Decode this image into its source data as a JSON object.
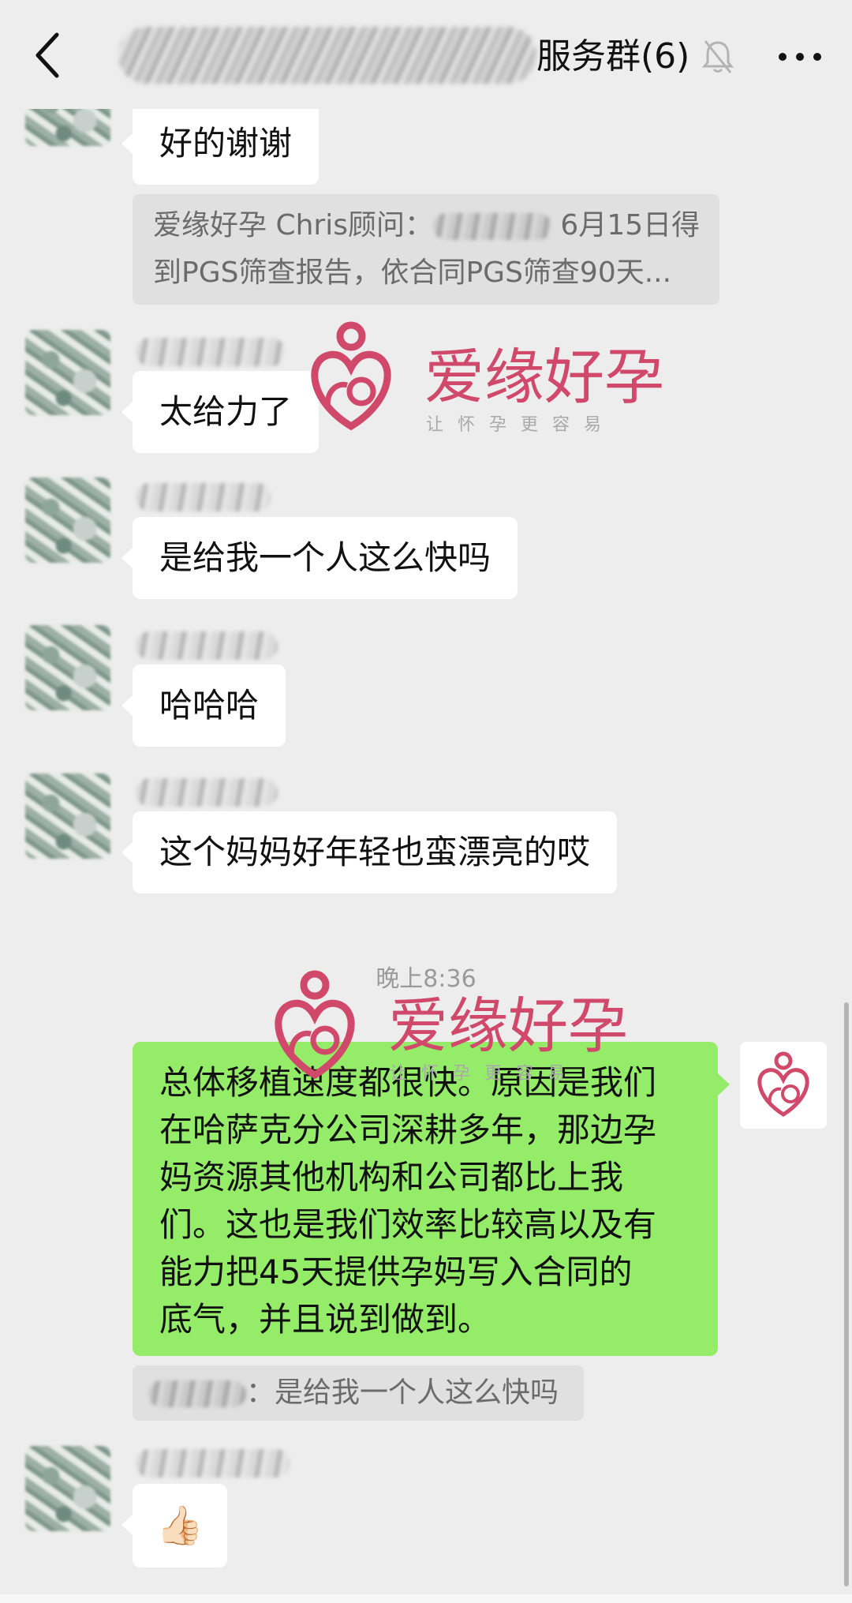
{
  "header": {
    "title": "服务群(6)",
    "back_icon": "chevron-left-icon",
    "mute_icon": "bell-muted-icon",
    "more_icon": "more-dots-icon"
  },
  "messages": {
    "m1": "好的谢谢",
    "quote1": {
      "line1_sender": "爱缘好孕 Chris顾问：",
      "line1_tail": " 6月15日得",
      "line2": "到PGS筛查报告，依合同PGS筛查90天..."
    },
    "m2": "太给力了",
    "m3": "是给我一个人这么快吗",
    "m4": "哈哈哈",
    "m5": "这个妈妈好年轻也蛮漂亮的哎",
    "time": "晚上8:36",
    "mine_lines": [
      "总体移植速度都很快。原因是我们",
      "在哈萨克分公司深耕多年，那边孕",
      "妈资源其他机构和公司都比上我",
      "们。这也是我们效率比较高以及有",
      "能力把45天提供孕妈写入合同的",
      "底气，并且说到做到。"
    ],
    "quote2": "：是给我一个人这么快吗",
    "last_emoji": "👍🏻"
  },
  "watermark": {
    "name": "爱缘好孕",
    "tagline": "让怀孕更容易"
  },
  "colors": {
    "background": "#ededed",
    "my_bubble": "#95ec69",
    "watermark_red": "#d0486a"
  }
}
